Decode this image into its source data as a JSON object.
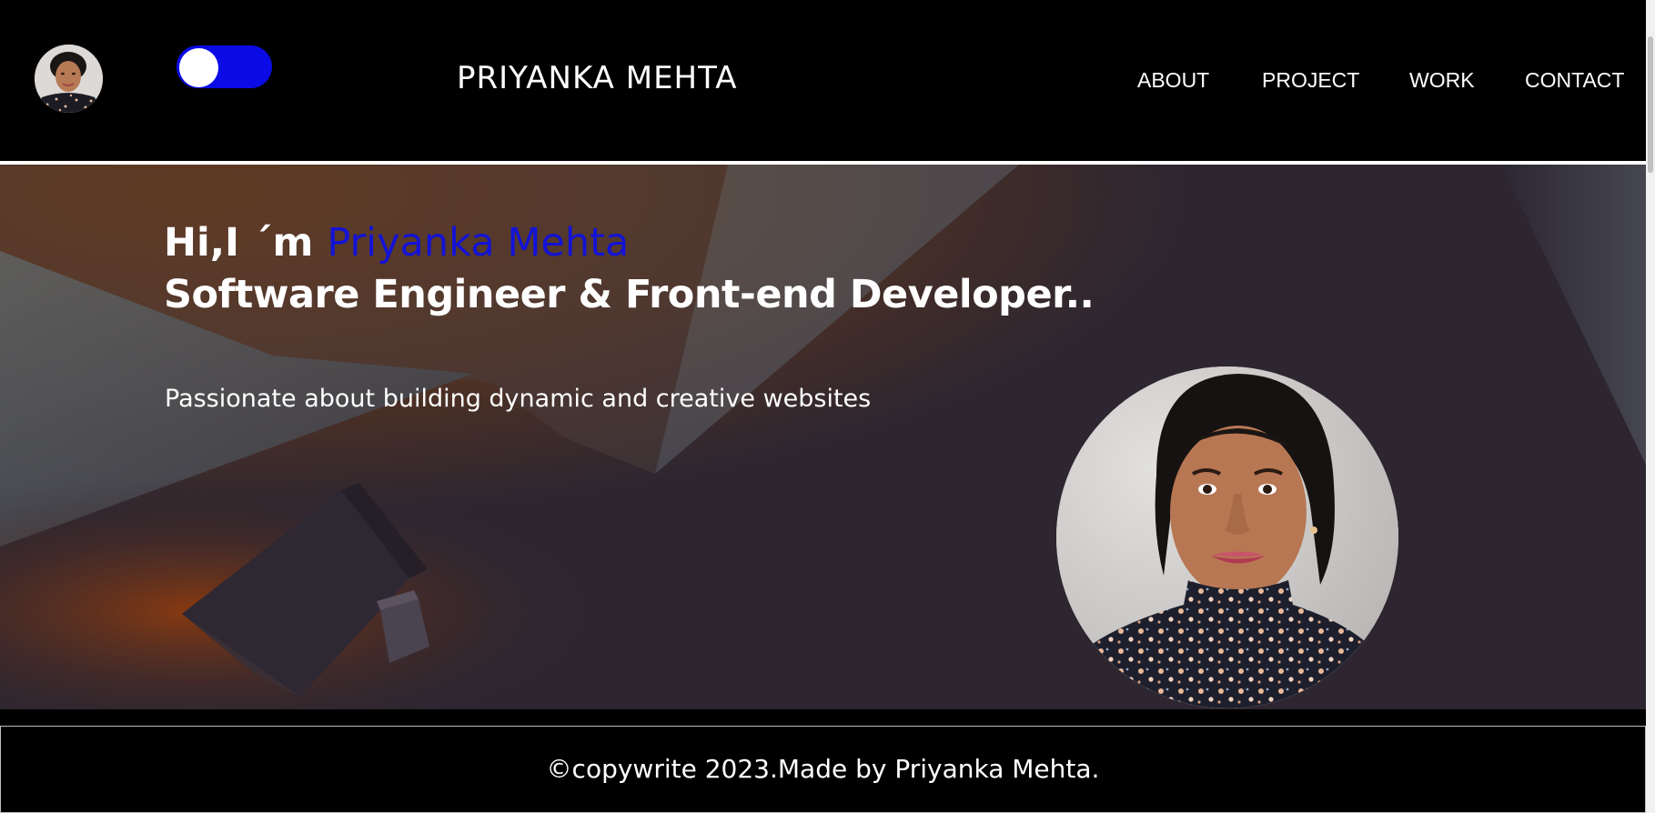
{
  "nav": {
    "brand": "PRIYANKA MEHTA",
    "links": [
      {
        "label": "ABOUT"
      },
      {
        "label": "PROJECT"
      },
      {
        "label": "WORK"
      },
      {
        "label": "CONTACT"
      }
    ],
    "theme_toggle": {
      "state": "on",
      "accent": "#0b0be6"
    }
  },
  "hero": {
    "greeting": "Hi,I ´m ",
    "name": "Priyanka Mehta",
    "title": "Software Engineer & Front-end Developer..",
    "tagline": "Passionate about building dynamic and creative websites",
    "name_color": "#1313d6"
  },
  "footer": {
    "text": "©copywrite 2023.Made by Priyanka Mehta."
  },
  "icons": {
    "avatar": "profile-photo",
    "hero_photo": "profile-photo"
  }
}
